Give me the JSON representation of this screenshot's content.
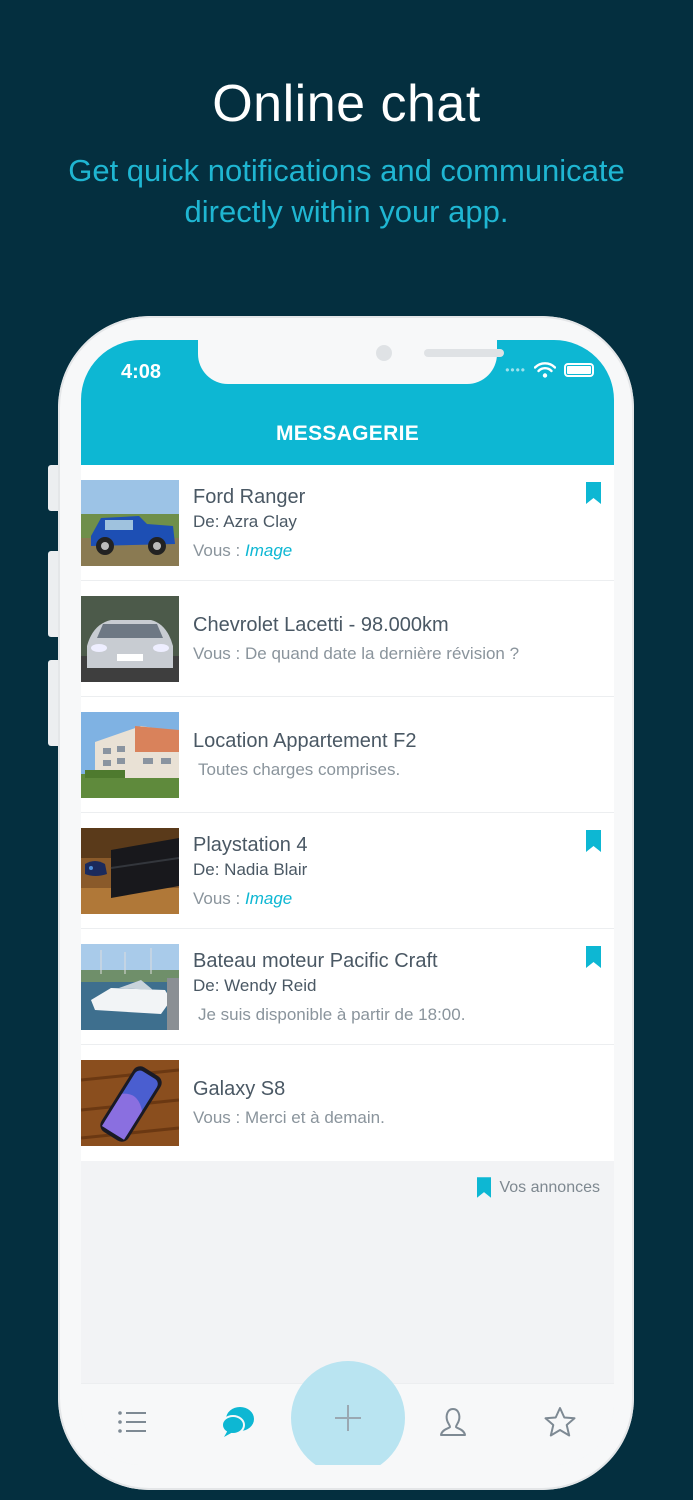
{
  "promo": {
    "title": "Online chat",
    "subtitle": "Get quick notifications and communicate directly within your app."
  },
  "status_bar": {
    "time": "4:08",
    "icons": [
      "signal-dots-icon",
      "wifi-icon",
      "battery-icon"
    ]
  },
  "header": {
    "title": "MESSAGERIE"
  },
  "colors": {
    "accent": "#0db7d3",
    "background": "#042f3f",
    "fab": "#b9e4f1",
    "text": "#4a5864",
    "muted": "#8a949c"
  },
  "conversations": [
    {
      "title": "Ford Ranger",
      "from": "De: Azra Clay",
      "prefix": "Vous : ",
      "message": "Image",
      "message_is_image": true,
      "bookmarked": true,
      "thumb": "blue-pickup-truck"
    },
    {
      "title": "Chevrolet Lacetti - 98.000km",
      "from": "",
      "prefix": "Vous : ",
      "message": "De quand date la dernière révision ?",
      "message_is_image": false,
      "bookmarked": false,
      "thumb": "silver-sedan"
    },
    {
      "title": "Location Appartement F2",
      "from": "",
      "prefix": "",
      "message": "Toutes charges comprises.",
      "message_is_image": false,
      "bookmarked": false,
      "thumb": "apartment-building"
    },
    {
      "title": "Playstation 4",
      "from": "De: Nadia Blair",
      "prefix": "Vous : ",
      "message": "Image",
      "message_is_image": true,
      "bookmarked": true,
      "thumb": "game-console"
    },
    {
      "title": "Bateau moteur Pacific Craft",
      "from": "De: Wendy Reid",
      "prefix": "",
      "message": "Je suis disponible à partir de 18:00.",
      "message_is_image": false,
      "bookmarked": true,
      "thumb": "motor-boat"
    },
    {
      "title": "Galaxy S8",
      "from": "",
      "prefix": "Vous : ",
      "message": "Merci et à demain.",
      "message_is_image": false,
      "bookmarked": false,
      "thumb": "smartphone"
    }
  ],
  "legend": {
    "label": "Vos annonces"
  },
  "tabbar": {
    "tabs": [
      {
        "icon": "list-icon",
        "active": false
      },
      {
        "icon": "chat-bubble-icon",
        "active": true
      },
      {
        "icon": "plus-icon",
        "active": false
      },
      {
        "icon": "user-icon",
        "active": false
      },
      {
        "icon": "star-icon",
        "active": false
      }
    ]
  }
}
